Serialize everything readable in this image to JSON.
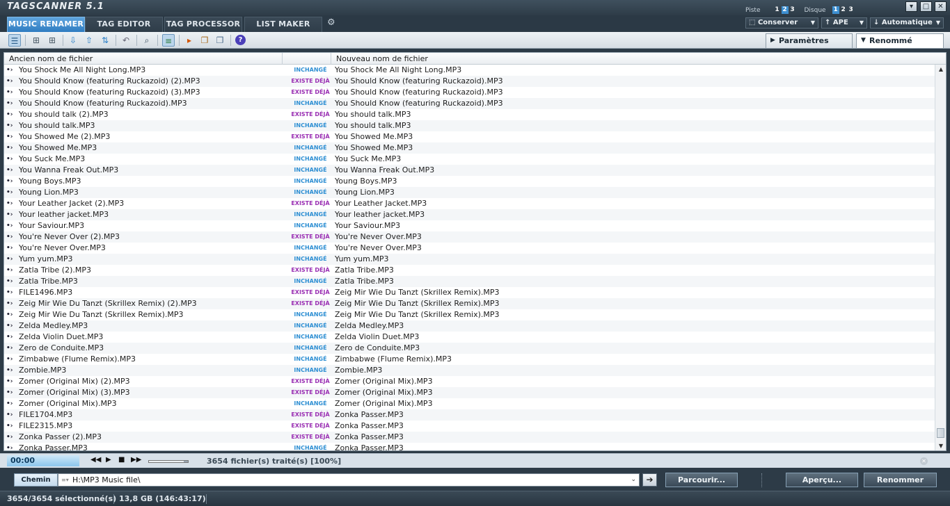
{
  "app": {
    "title": "TAGSCANNER 5.1"
  },
  "titlebar": {
    "piste_label": "Piste",
    "disque_label": "Disque",
    "numbers": [
      "1",
      "2",
      "3"
    ]
  },
  "tabs": [
    {
      "label": "MUSIC RENAMER",
      "active": true
    },
    {
      "label": "TAG EDITOR"
    },
    {
      "label": "TAG PROCESSOR"
    },
    {
      "label": "LIST MAKER"
    }
  ],
  "dropdowns": {
    "conserver": "Conserver",
    "ape": "APE",
    "auto": "Automatique"
  },
  "panel_tabs": {
    "parametres": "Paramètres",
    "renomme": "Renommé"
  },
  "list": {
    "headers": {
      "old": "Ancien nom de fichier",
      "status": "",
      "new": "Nouveau nom de fichier"
    },
    "status_colors": {
      "inchange": "#2e8fd3",
      "existe": "#9a2fb3"
    },
    "rows": [
      {
        "old": "You Shock Me All Night Long.MP3",
        "status": "INCHANGÉ",
        "new": "You Shock Me All Night Long.MP3"
      },
      {
        "old": "You Should Know (featuring Ruckazoid) (2).MP3",
        "status": "EXISTE DÉJÀ",
        "new": "You Should Know (featuring Ruckazoid).MP3"
      },
      {
        "old": "You Should Know (featuring Ruckazoid) (3).MP3",
        "status": "EXISTE DÉJÀ",
        "new": "You Should Know (featuring Ruckazoid).MP3"
      },
      {
        "old": "You Should Know (featuring Ruckazoid).MP3",
        "status": "INCHANGÉ",
        "new": "You Should Know (featuring Ruckazoid).MP3"
      },
      {
        "old": "You should talk (2).MP3",
        "status": "EXISTE DÉJÀ",
        "new": "You should talk.MP3"
      },
      {
        "old": "You should talk.MP3",
        "status": "INCHANGÉ",
        "new": "You should talk.MP3"
      },
      {
        "old": "You Showed Me (2).MP3",
        "status": "EXISTE DÉJÀ",
        "new": "You Showed Me.MP3"
      },
      {
        "old": "You Showed Me.MP3",
        "status": "INCHANGÉ",
        "new": "You Showed Me.MP3"
      },
      {
        "old": "You Suck Me.MP3",
        "status": "INCHANGÉ",
        "new": "You Suck Me.MP3"
      },
      {
        "old": "You Wanna Freak Out.MP3",
        "status": "INCHANGÉ",
        "new": "You Wanna Freak Out.MP3"
      },
      {
        "old": "Young Boys.MP3",
        "status": "INCHANGÉ",
        "new": "Young Boys.MP3"
      },
      {
        "old": "Young Lion.MP3",
        "status": "INCHANGÉ",
        "new": "Young Lion.MP3"
      },
      {
        "old": "Your Leather Jacket (2).MP3",
        "status": "EXISTE DÉJÀ",
        "new": "Your Leather Jacket.MP3"
      },
      {
        "old": "Your leather jacket.MP3",
        "status": "INCHANGÉ",
        "new": "Your leather jacket.MP3"
      },
      {
        "old": "Your Saviour.MP3",
        "status": "INCHANGÉ",
        "new": "Your Saviour.MP3"
      },
      {
        "old": "You're Never Over (2).MP3",
        "status": "EXISTE DÉJÀ",
        "new": "You're Never Over.MP3"
      },
      {
        "old": "You're Never Over.MP3",
        "status": "INCHANGÉ",
        "new": "You're Never Over.MP3"
      },
      {
        "old": "Yum yum.MP3",
        "status": "INCHANGÉ",
        "new": "Yum yum.MP3"
      },
      {
        "old": "Zatla Tribe (2).MP3",
        "status": "EXISTE DÉJÀ",
        "new": "Zatla Tribe.MP3"
      },
      {
        "old": "Zatla Tribe.MP3",
        "status": "INCHANGÉ",
        "new": "Zatla Tribe.MP3"
      },
      {
        "old": "FILE1496.MP3",
        "status": "EXISTE DÉJÀ",
        "new": "Zeig Mir Wie Du Tanzt (Skrillex Remix).MP3"
      },
      {
        "old": "Zeig Mir Wie Du Tanzt (Skrillex Remix) (2).MP3",
        "status": "EXISTE DÉJÀ",
        "new": "Zeig Mir Wie Du Tanzt (Skrillex Remix).MP3"
      },
      {
        "old": "Zeig Mir Wie Du Tanzt (Skrillex Remix).MP3",
        "status": "INCHANGÉ",
        "new": "Zeig Mir Wie Du Tanzt (Skrillex Remix).MP3"
      },
      {
        "old": "Zelda Medley.MP3",
        "status": "INCHANGÉ",
        "new": "Zelda Medley.MP3"
      },
      {
        "old": "Zelda Violin Duet.MP3",
        "status": "INCHANGÉ",
        "new": "Zelda Violin Duet.MP3"
      },
      {
        "old": "Zero de Conduite.MP3",
        "status": "INCHANGÉ",
        "new": "Zero de Conduite.MP3"
      },
      {
        "old": "Zimbabwe (Flume Remix).MP3",
        "status": "INCHANGÉ",
        "new": "Zimbabwe (Flume Remix).MP3"
      },
      {
        "old": "Zombie.MP3",
        "status": "INCHANGÉ",
        "new": "Zombie.MP3"
      },
      {
        "old": "Zomer (Original Mix) (2).MP3",
        "status": "EXISTE DÉJÀ",
        "new": "Zomer (Original Mix).MP3"
      },
      {
        "old": "Zomer (Original Mix) (3).MP3",
        "status": "EXISTE DÉJÀ",
        "new": "Zomer (Original Mix).MP3"
      },
      {
        "old": "Zomer (Original Mix).MP3",
        "status": "INCHANGÉ",
        "new": "Zomer (Original Mix).MP3"
      },
      {
        "old": "FILE1704.MP3",
        "status": "EXISTE DÉJÀ",
        "new": "Zonka Passer.MP3"
      },
      {
        "old": "FILE2315.MP3",
        "status": "EXISTE DÉJÀ",
        "new": "Zonka Passer.MP3"
      },
      {
        "old": "Zonka Passer (2).MP3",
        "status": "EXISTE DÉJÀ",
        "new": "Zonka Passer.MP3"
      },
      {
        "old": "Zonka Passer.MP3",
        "status": "INCHANGÉ",
        "new": "Zonka Passer.MP3"
      }
    ]
  },
  "player": {
    "time": "00:00",
    "processed": "3654 fichier(s) traité(s) [100%]",
    "progress": 0.9
  },
  "path": {
    "label": "Chemin",
    "value": "H:\\MP3 Music file\\",
    "parcourir": "Parcourir...",
    "apercu": "Aperçu...",
    "renommer": "Renommer"
  },
  "status": {
    "selected": "3654/3654 sélectionné(s)",
    "size": "13,8 GB (146:43:17)"
  }
}
